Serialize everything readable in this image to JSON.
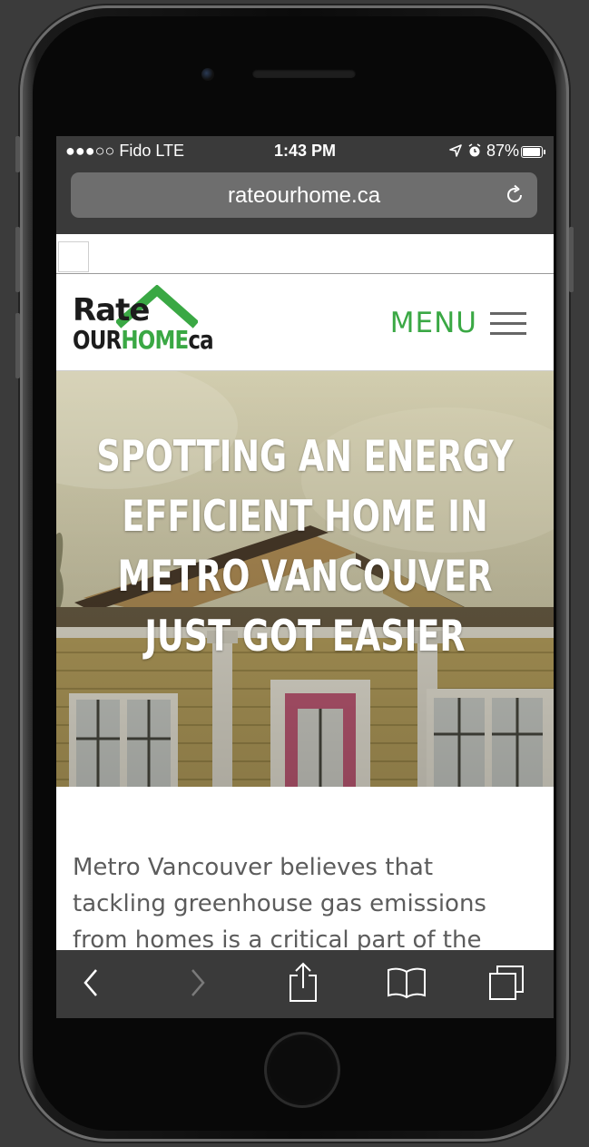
{
  "status_bar": {
    "carrier": "●●●○○ Fido  LTE",
    "time": "1:43 PM",
    "right_status": "87%"
  },
  "browser": {
    "url": "rateourhome.ca"
  },
  "site": {
    "logo": {
      "line1": "Rate",
      "line2_dark": "OUR",
      "line2_green": "HOME",
      "line2_suffix": "ca"
    },
    "menu_label": "MENU",
    "hero_title": [
      "SPOTTING AN ENERGY",
      "EFFICIENT HOME IN",
      "METRO VANCOUVER",
      "JUST GOT EASIER"
    ],
    "intro_lines": [
      "Metro Vancouver believes that",
      "tackling greenhouse gas emissions",
      "from homes is a critical part of the"
    ]
  },
  "colors": {
    "brand_green": "#3aa844",
    "browser_chrome": "#3a3a3a"
  },
  "icons": {
    "reload": "reload-icon",
    "back": "chevron-left-icon",
    "forward": "chevron-right-icon",
    "share": "share-icon",
    "bookmarks": "book-icon",
    "tabs": "tabs-icon"
  }
}
